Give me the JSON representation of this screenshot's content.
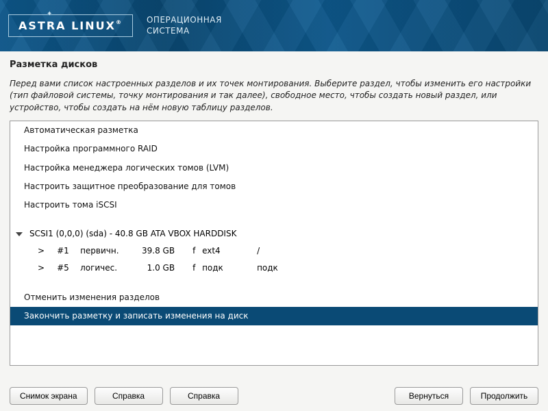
{
  "header": {
    "brand": "ASTRA LINUX",
    "subtitle_line1": "ОПЕРАЦИОННАЯ",
    "subtitle_line2": "СИСТЕМА"
  },
  "page": {
    "title": "Разметка дисков",
    "intro": "Перед вами список настроенных разделов и их точек монтирования. Выберите раздел, чтобы изменить его настройки (тип файловой системы, точку монтирования и так далее), свободное место, чтобы создать новый раздел, или устройство, чтобы создать на нём новую таблицу разделов."
  },
  "menu": {
    "auto": "Автоматическая разметка",
    "raid": "Настройка программного RAID",
    "lvm": "Настройка менеджера логических томов (LVM)",
    "encrypt": "Настроить защитное преобразование для томов",
    "iscsi": "Настроить тома iSCSI"
  },
  "disk": {
    "label": "SCSI1 (0,0,0) (sda) - 40.8 GB ATA VBOX HARDDISK",
    "partitions": [
      {
        "num": "#1",
        "ptype": "первичн.",
        "size": "39.8 GB",
        "flag": "f",
        "fs": "ext4",
        "mount": "/"
      },
      {
        "num": "#5",
        "ptype": "логичес.",
        "size": "1.0 GB",
        "flag": "f",
        "fs": "подк",
        "mount": "подк"
      }
    ]
  },
  "actions": {
    "undo": "Отменить изменения разделов",
    "finish": "Закончить разметку и записать изменения на диск"
  },
  "footer": {
    "screenshot": "Снимок экрана",
    "help1": "Справка",
    "help2": "Справка",
    "back": "Вернуться",
    "continue": "Продолжить"
  }
}
